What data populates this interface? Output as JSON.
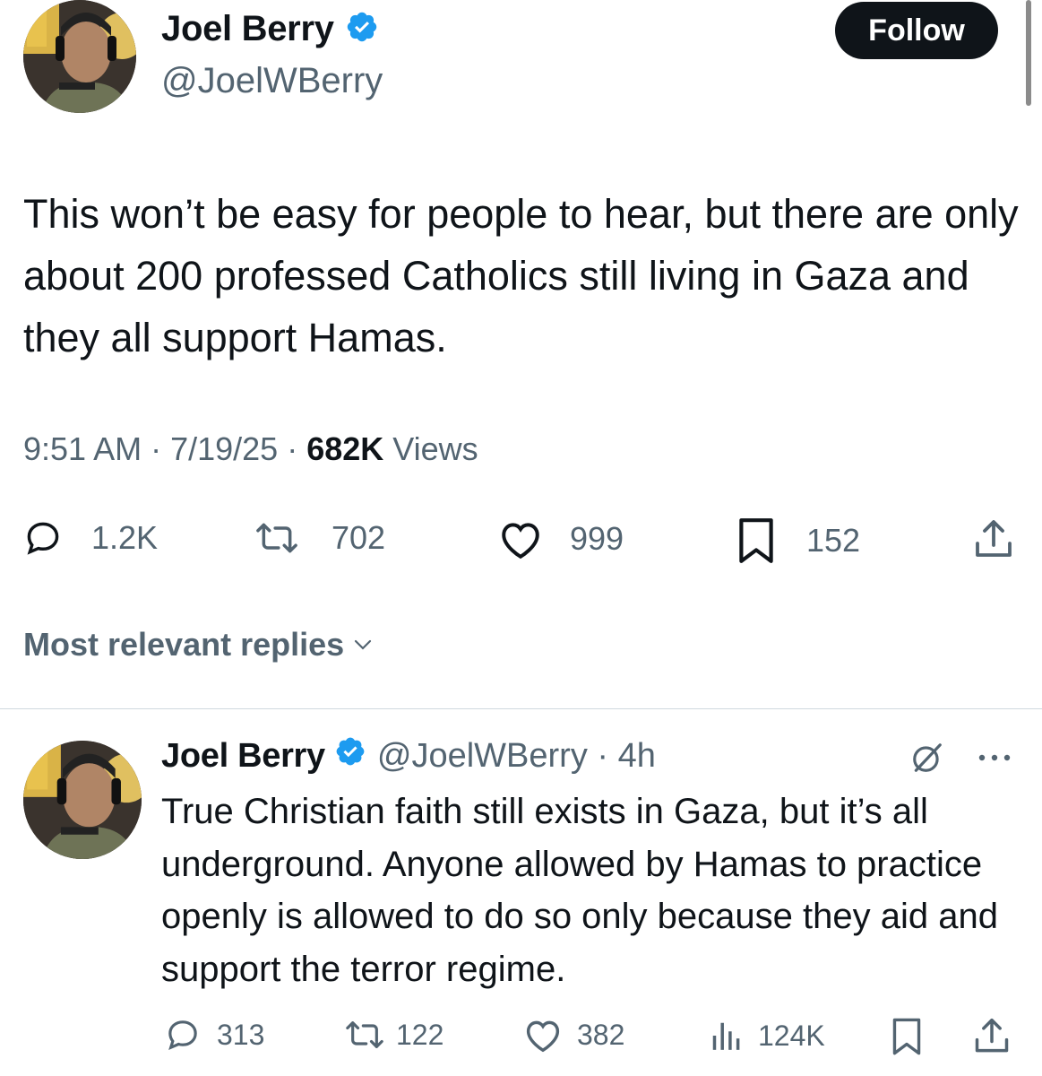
{
  "tweet": {
    "author_name": "Joel Berry",
    "handle": "@JoelWBerry",
    "follow_label": "Follow",
    "text": "This won’t be easy for people to hear, but there are only about 200 professed Catholics still living in Gaza and they all support Hamas.",
    "time": "9:51 AM",
    "date": "7/19/25",
    "views_count": "682K",
    "views_label": "Views",
    "replies": "1.2K",
    "reposts": "702",
    "likes": "999",
    "bookmarks": "152"
  },
  "replies_filter": {
    "label": "Most relevant replies"
  },
  "reply": {
    "author_name": "Joel Berry",
    "handle": "@JoelWBerry",
    "age": "4h",
    "text": "True Christian faith still exists in Gaza, but it’s all underground. Anyone allowed by Hamas to practice openly is allowed to do so only because they aid and support the terror regime.",
    "replies": "313",
    "reposts": "122",
    "likes": "382",
    "views": "124K"
  },
  "colors": {
    "text": "#0f1419",
    "secondary": "#536471",
    "verified": "#1d9bf0",
    "divider": "#cfd9de"
  },
  "icons": [
    "verified-badge-icon",
    "reply-icon",
    "repost-icon",
    "like-icon",
    "bookmark-icon",
    "share-icon",
    "views-icon",
    "grok-icon",
    "more-icon",
    "chevron-down-icon"
  ]
}
